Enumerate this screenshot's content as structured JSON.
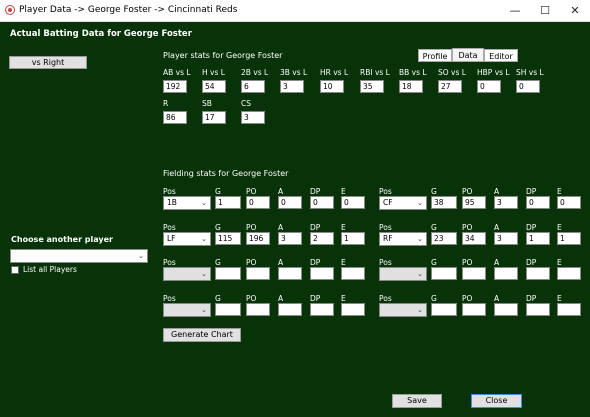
{
  "window": {
    "title": "Player Data -> George Foster -> Cincinnati Reds",
    "close_glyph": "✕",
    "minimize_glyph": "—",
    "maximize_glyph": "☐"
  },
  "tabs": [
    "Profile",
    "Data",
    "Editor"
  ],
  "header": "Actual Batting Data for George Foster",
  "vs_button": "vs Right",
  "player_stats": {
    "title": "Player stats for George Foster",
    "row1": [
      {
        "label": "AB vs L",
        "value": "192"
      },
      {
        "label": "H vs L",
        "value": "54"
      },
      {
        "label": "2B vs L",
        "value": "6"
      },
      {
        "label": "3B vs L",
        "value": "3"
      },
      {
        "label": "HR vs L",
        "value": "10"
      },
      {
        "label": "RBI vs L",
        "value": "35"
      },
      {
        "label": "BB vs L",
        "value": "18"
      },
      {
        "label": "SO vs L",
        "value": "27"
      },
      {
        "label": "HBP vs L",
        "value": "0"
      },
      {
        "label": "SH vs L",
        "value": "0"
      }
    ],
    "row2": [
      {
        "label": "R",
        "value": "86"
      },
      {
        "label": "SB",
        "value": "17"
      },
      {
        "label": "CS",
        "value": "3"
      }
    ]
  },
  "fielding": {
    "title": "Fielding stats for George Foster",
    "headers": [
      "Pos",
      "G",
      "PO",
      "A",
      "DP",
      "E"
    ],
    "rows": [
      [
        {
          "pos": "1B",
          "G": "1",
          "PO": "0",
          "A": "0",
          "DP": "0",
          "E": "0"
        },
        {
          "pos": "CF",
          "G": "38",
          "PO": "95",
          "A": "3",
          "DP": "0",
          "E": "0"
        }
      ],
      [
        {
          "pos": "LF",
          "G": "115",
          "PO": "196",
          "A": "3",
          "DP": "2",
          "E": "1"
        },
        {
          "pos": "RF",
          "G": "23",
          "PO": "34",
          "A": "3",
          "DP": "1",
          "E": "1"
        }
      ],
      [
        {
          "pos": "",
          "G": "",
          "PO": "",
          "A": "",
          "DP": "",
          "E": ""
        },
        {
          "pos": "",
          "G": "",
          "PO": "",
          "A": "",
          "DP": "",
          "E": ""
        }
      ],
      [
        {
          "pos": "",
          "G": "",
          "PO": "",
          "A": "",
          "DP": "",
          "E": ""
        },
        {
          "pos": "",
          "G": "",
          "PO": "",
          "A": "",
          "DP": "",
          "E": ""
        }
      ]
    ],
    "generate_chart": "Generate Chart"
  },
  "choose_player": {
    "label": "Choose another player",
    "selected": "",
    "list_all": "List all Players"
  },
  "footer": {
    "save": "Save",
    "close": "Close"
  }
}
